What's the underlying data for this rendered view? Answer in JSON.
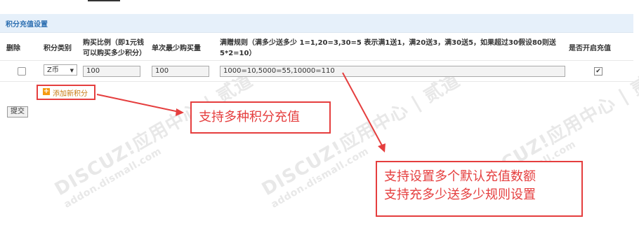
{
  "section": {
    "title": "积分充值设置"
  },
  "table": {
    "headers": {
      "delete": "删除",
      "type": "积分类别",
      "ratio_line1": "购买比例（即1元钱",
      "ratio_line2": "可以购买多少积分）",
      "min": "单次最少购买量",
      "rule_line1": "满赠规则（满多少送多少 1=1,20=3,30=5 表示满1送1，满20送3，满30送5，如果超过30假设80则送",
      "rule_line2": "5*2=10）",
      "enable": "是否开启充值"
    },
    "row": {
      "type_value": "Z币",
      "ratio_value": "100",
      "min_value": "100",
      "rule_value": "1000=10,5000=55,10000=110",
      "enabled_mark": "✔"
    }
  },
  "add_link": {
    "label": "添加新积分"
  },
  "submit": {
    "label": "提交"
  },
  "callouts": {
    "c1": "支持多种积分充值",
    "c2_line1": "支持设置多个默认充值数额",
    "c2_line2": "支持充多少送多少规则设置"
  },
  "watermark": {
    "brand": "DISCUZ!",
    "cn": "应用中心",
    "sub": "addon.dismall.com",
    "mark": "贰道"
  },
  "colors": {
    "header_bg": "#e6f0fa",
    "title_blue": "#2a6db0",
    "accent_red": "#e53e3e",
    "add_orange": "#f59a12"
  }
}
